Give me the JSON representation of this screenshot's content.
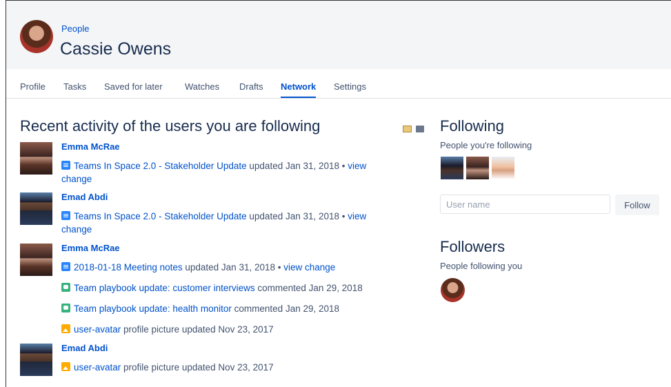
{
  "header": {
    "breadcrumb": "People",
    "title": "Cassie Owens"
  },
  "tabs": [
    {
      "label": "Profile"
    },
    {
      "label": "Tasks"
    },
    {
      "label": "Saved for later"
    },
    {
      "label": "Watches"
    },
    {
      "label": "Drafts"
    },
    {
      "label": "Network"
    },
    {
      "label": "Settings"
    }
  ],
  "activity": {
    "heading": "Recent activity of the users you are following",
    "users": [
      {
        "name": "Emma McRae",
        "items": [
          {
            "icon": "page-icon",
            "link": "Teams In Space 2.0 - Stakeholder Update",
            "text": " updated Jan 31, 2018 • ",
            "extra": "view change"
          }
        ]
      },
      {
        "name": "Emad Abdi",
        "items": [
          {
            "icon": "page-icon",
            "link": "Teams In Space 2.0 - Stakeholder Update",
            "text": " updated Jan 31, 2018 • ",
            "extra": "view change"
          }
        ]
      },
      {
        "name": "Emma McRae",
        "items": [
          {
            "icon": "page-icon",
            "link": "2018-01-18 Meeting notes",
            "text": " updated Jan 31, 2018 • ",
            "extra": "view change"
          },
          {
            "icon": "comment-icon",
            "link": "Team playbook update: customer interviews",
            "text": " commented Jan 29, 2018"
          },
          {
            "icon": "comment-icon",
            "link": "Team playbook update: health monitor",
            "text": " commented Jan 29, 2018"
          },
          {
            "icon": "picture-icon",
            "link": "user-avatar",
            "text": " profile picture updated Nov 23, 2017"
          }
        ]
      },
      {
        "name": "Emad Abdi",
        "items": [
          {
            "icon": "picture-icon",
            "link": "user-avatar",
            "text": " profile picture updated Nov 23, 2017"
          }
        ]
      }
    ]
  },
  "following": {
    "heading": "Following",
    "subheading": "People you're following",
    "input_placeholder": "User name",
    "button": "Follow"
  },
  "followers": {
    "heading": "Followers",
    "subheading": "People following you"
  },
  "colors": {
    "link": "#0052cc",
    "page_icon": "#2684ff",
    "comment_icon": "#36b37e",
    "picture_icon": "#ffab00"
  }
}
